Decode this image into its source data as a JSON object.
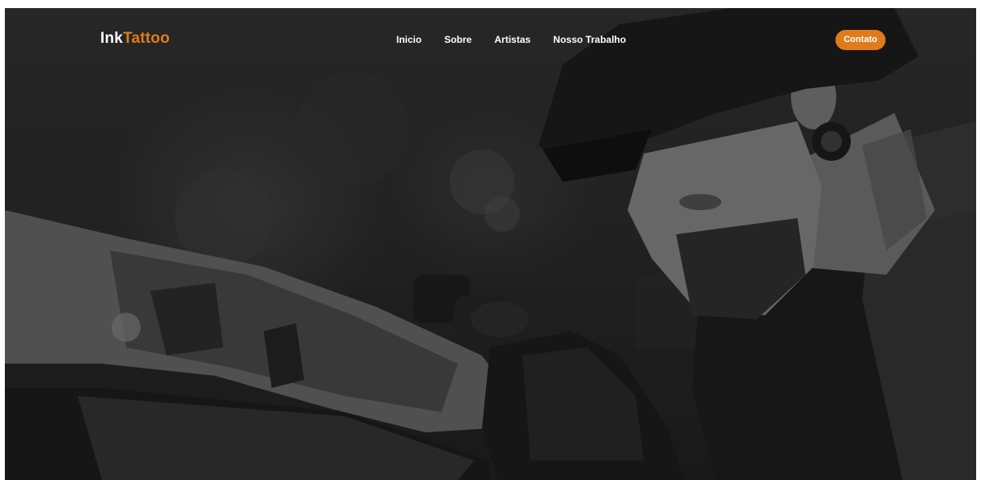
{
  "brand": {
    "logo_part1": "Ink",
    "logo_part2": "Tattoo",
    "accent_color": "#e07b1c"
  },
  "nav": {
    "items": [
      {
        "label": "Inicio"
      },
      {
        "label": "Sobre"
      },
      {
        "label": "Artistas"
      },
      {
        "label": "Nosso Trabalho"
      }
    ],
    "cta_label": "Contato"
  },
  "hero": {
    "image_subject": "tattoo artist tattooing an arm, grayscale photo"
  }
}
